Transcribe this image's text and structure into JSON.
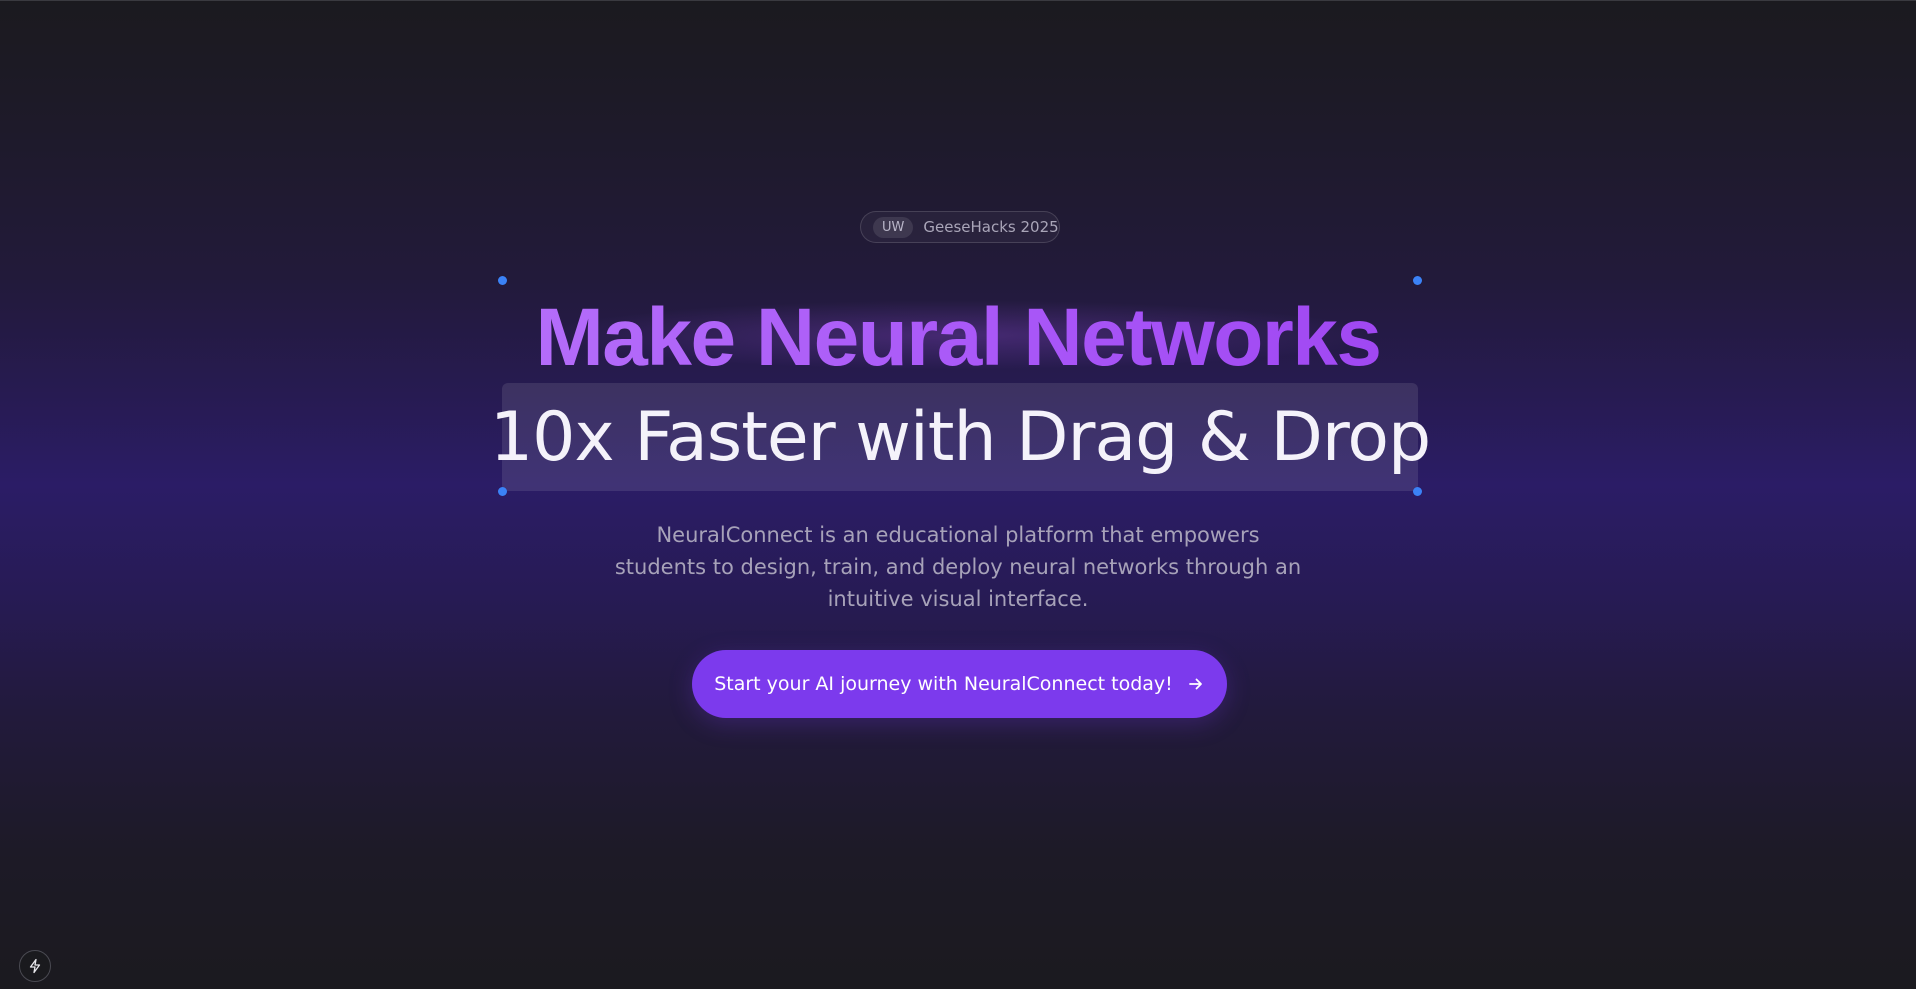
{
  "badge": {
    "tag": "UW",
    "text": "GeeseHacks 2025"
  },
  "hero": {
    "headline": "Make Neural Networks",
    "subheadline": "10x Faster with Drag & Drop",
    "description": "NeuralConnect is an educational platform that empowers students to design, train, and deploy neural networks through an intuitive visual interface."
  },
  "cta": {
    "label": "Start your AI journey with NeuralConnect today!",
    "icon": "arrow-right-icon"
  },
  "corner": {
    "icon": "lightning-icon"
  },
  "colors": {
    "accent": "#7c3aed",
    "headline_gradient_start": "#c084fc",
    "headline_gradient_end": "#9333ea",
    "selection_handle": "#3b82f6",
    "background": "#1c1b21"
  }
}
